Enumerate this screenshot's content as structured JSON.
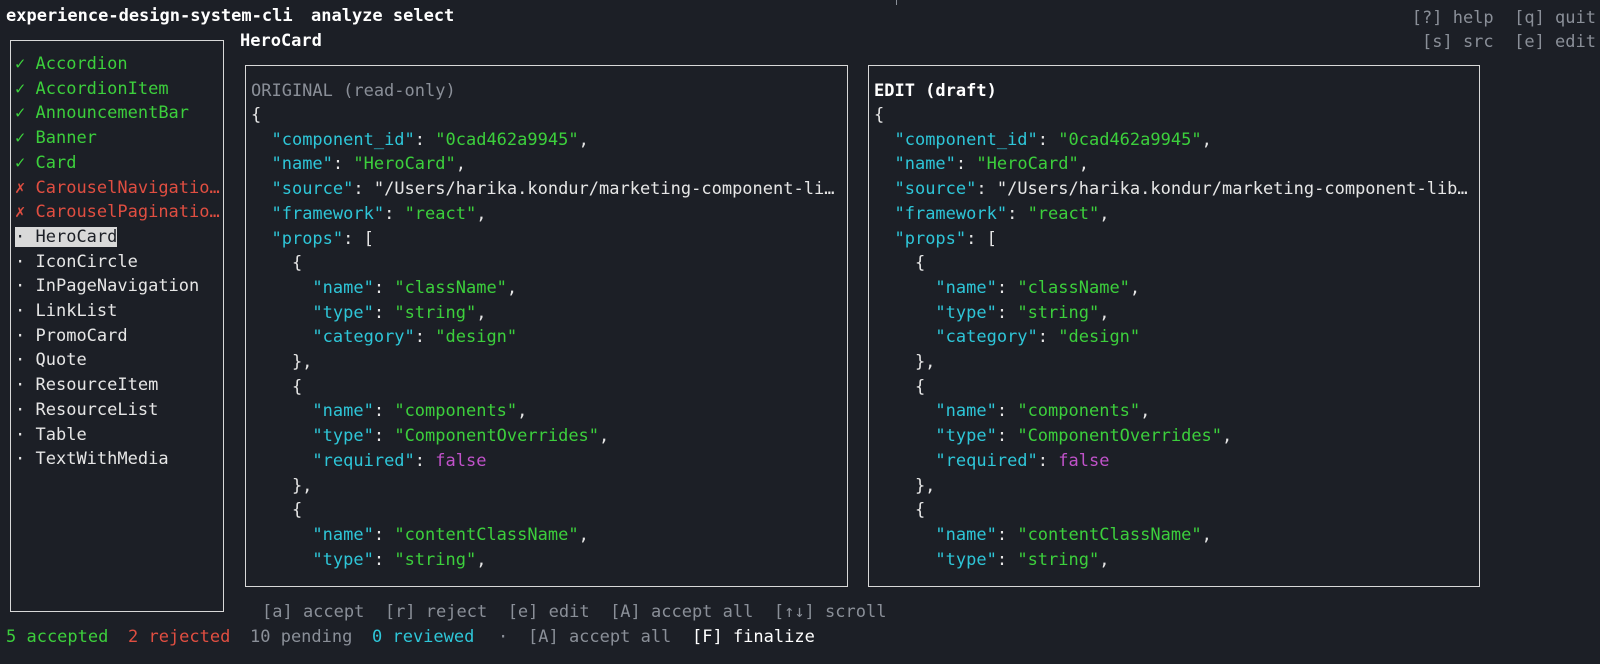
{
  "header": {
    "command": "experience-design-system-cli",
    "mode": "analyze select",
    "hints_row1": "[?] help  [q] quit",
    "hints_row2": "[s] src  [e] edit"
  },
  "selected_component": "HeroCard",
  "sidebar": {
    "items": [
      {
        "mark": "✓",
        "label": "Accordion",
        "status": "accepted"
      },
      {
        "mark": "✓",
        "label": "AccordionItem",
        "status": "accepted"
      },
      {
        "mark": "✓",
        "label": "AnnouncementBar",
        "status": "accepted"
      },
      {
        "mark": "✓",
        "label": "Banner",
        "status": "accepted"
      },
      {
        "mark": "✓",
        "label": "Card",
        "status": "accepted"
      },
      {
        "mark": "✗",
        "label": "CarouselNavigatio…",
        "status": "rejected"
      },
      {
        "mark": "✗",
        "label": "CarouselPaginatio…",
        "status": "rejected"
      },
      {
        "mark": "·",
        "label": "HeroCard",
        "status": "selected"
      },
      {
        "mark": "·",
        "label": "IconCircle",
        "status": "pending"
      },
      {
        "mark": "·",
        "label": "InPageNavigation",
        "status": "pending"
      },
      {
        "mark": "·",
        "label": "LinkList",
        "status": "pending"
      },
      {
        "mark": "·",
        "label": "PromoCard",
        "status": "pending"
      },
      {
        "mark": "·",
        "label": "Quote",
        "status": "pending"
      },
      {
        "mark": "·",
        "label": "ResourceItem",
        "status": "pending"
      },
      {
        "mark": "·",
        "label": "ResourceList",
        "status": "pending"
      },
      {
        "mark": "·",
        "label": "Table",
        "status": "pending"
      },
      {
        "mark": "·",
        "label": "TextWithMedia",
        "status": "pending"
      }
    ]
  },
  "panels": {
    "original_header": "ORIGINAL (read-only)",
    "edit_header": "EDIT (draft)",
    "original_lines": [
      [
        [
          "p",
          "{"
        ]
      ],
      [
        [
          "p",
          "  "
        ],
        [
          "k",
          "\"component_id\""
        ],
        [
          "p",
          ": "
        ],
        [
          "s",
          "\"0cad462a9945\""
        ],
        [
          "p",
          ","
        ]
      ],
      [
        [
          "p",
          "  "
        ],
        [
          "k",
          "\"name\""
        ],
        [
          "p",
          ": "
        ],
        [
          "s",
          "\"HeroCard\""
        ],
        [
          "p",
          ","
        ]
      ],
      [
        [
          "p",
          "  "
        ],
        [
          "k",
          "\"source\""
        ],
        [
          "p",
          ": \"/Users/harika.kondur/marketing-component-lib…"
        ]
      ],
      [
        [
          "p",
          "  "
        ],
        [
          "k",
          "\"framework\""
        ],
        [
          "p",
          ": "
        ],
        [
          "s",
          "\"react\""
        ],
        [
          "p",
          ","
        ]
      ],
      [
        [
          "p",
          "  "
        ],
        [
          "k",
          "\"props\""
        ],
        [
          "p",
          ": ["
        ]
      ],
      [
        [
          "p",
          "    {"
        ]
      ],
      [
        [
          "p",
          "      "
        ],
        [
          "k",
          "\"name\""
        ],
        [
          "p",
          ": "
        ],
        [
          "s",
          "\"className\""
        ],
        [
          "p",
          ","
        ]
      ],
      [
        [
          "p",
          "      "
        ],
        [
          "k",
          "\"type\""
        ],
        [
          "p",
          ": "
        ],
        [
          "s",
          "\"string\""
        ],
        [
          "p",
          ","
        ]
      ],
      [
        [
          "p",
          "      "
        ],
        [
          "k",
          "\"category\""
        ],
        [
          "p",
          ": "
        ],
        [
          "s",
          "\"design\""
        ]
      ],
      [
        [
          "p",
          "    },"
        ]
      ],
      [
        [
          "p",
          "    {"
        ]
      ],
      [
        [
          "p",
          "      "
        ],
        [
          "k",
          "\"name\""
        ],
        [
          "p",
          ": "
        ],
        [
          "s",
          "\"components\""
        ],
        [
          "p",
          ","
        ]
      ],
      [
        [
          "p",
          "      "
        ],
        [
          "k",
          "\"type\""
        ],
        [
          "p",
          ": "
        ],
        [
          "s",
          "\"ComponentOverrides\""
        ],
        [
          "p",
          ","
        ]
      ],
      [
        [
          "p",
          "      "
        ],
        [
          "k",
          "\"required\""
        ],
        [
          "p",
          ": "
        ],
        [
          "b",
          "false"
        ]
      ],
      [
        [
          "p",
          "    },"
        ]
      ],
      [
        [
          "p",
          "    {"
        ]
      ],
      [
        [
          "p",
          "      "
        ],
        [
          "k",
          "\"name\""
        ],
        [
          "p",
          ": "
        ],
        [
          "s",
          "\"contentClassName\""
        ],
        [
          "p",
          ","
        ]
      ],
      [
        [
          "p",
          "      "
        ],
        [
          "k",
          "\"type\""
        ],
        [
          "p",
          ": "
        ],
        [
          "s",
          "\"string\""
        ],
        [
          "p",
          ","
        ]
      ]
    ],
    "edit_lines": [
      [
        [
          "p",
          "{"
        ]
      ],
      [
        [
          "p",
          "  "
        ],
        [
          "k",
          "\"component_id\""
        ],
        [
          "p",
          ": "
        ],
        [
          "s",
          "\"0cad462a9945\""
        ],
        [
          "p",
          ","
        ]
      ],
      [
        [
          "p",
          "  "
        ],
        [
          "k",
          "\"name\""
        ],
        [
          "p",
          ": "
        ],
        [
          "s",
          "\"HeroCard\""
        ],
        [
          "p",
          ","
        ]
      ],
      [
        [
          "p",
          "  "
        ],
        [
          "k",
          "\"source\""
        ],
        [
          "p",
          ": \"/Users/harika.kondur/marketing-component-libr…"
        ]
      ],
      [
        [
          "p",
          "  "
        ],
        [
          "k",
          "\"framework\""
        ],
        [
          "p",
          ": "
        ],
        [
          "s",
          "\"react\""
        ],
        [
          "p",
          ","
        ]
      ],
      [
        [
          "p",
          "  "
        ],
        [
          "k",
          "\"props\""
        ],
        [
          "p",
          ": ["
        ]
      ],
      [
        [
          "p",
          "    {"
        ]
      ],
      [
        [
          "p",
          "      "
        ],
        [
          "k",
          "\"name\""
        ],
        [
          "p",
          ": "
        ],
        [
          "s",
          "\"className\""
        ],
        [
          "p",
          ","
        ]
      ],
      [
        [
          "p",
          "      "
        ],
        [
          "k",
          "\"type\""
        ],
        [
          "p",
          ": "
        ],
        [
          "s",
          "\"string\""
        ],
        [
          "p",
          ","
        ]
      ],
      [
        [
          "p",
          "      "
        ],
        [
          "k",
          "\"category\""
        ],
        [
          "p",
          ": "
        ],
        [
          "s",
          "\"design\""
        ]
      ],
      [
        [
          "p",
          "    },"
        ]
      ],
      [
        [
          "p",
          "    {"
        ]
      ],
      [
        [
          "p",
          "      "
        ],
        [
          "k",
          "\"name\""
        ],
        [
          "p",
          ": "
        ],
        [
          "s",
          "\"components\""
        ],
        [
          "p",
          ","
        ]
      ],
      [
        [
          "p",
          "      "
        ],
        [
          "k",
          "\"type\""
        ],
        [
          "p",
          ": "
        ],
        [
          "s",
          "\"ComponentOverrides\""
        ],
        [
          "p",
          ","
        ]
      ],
      [
        [
          "p",
          "      "
        ],
        [
          "k",
          "\"required\""
        ],
        [
          "p",
          ": "
        ],
        [
          "b",
          "false"
        ]
      ],
      [
        [
          "p",
          "    },"
        ]
      ],
      [
        [
          "p",
          "    {"
        ]
      ],
      [
        [
          "p",
          "      "
        ],
        [
          "k",
          "\"name\""
        ],
        [
          "p",
          ": "
        ],
        [
          "s",
          "\"contentClassName\""
        ],
        [
          "p",
          ","
        ]
      ],
      [
        [
          "p",
          "      "
        ],
        [
          "k",
          "\"type\""
        ],
        [
          "p",
          ": "
        ],
        [
          "s",
          "\"string\""
        ],
        [
          "p",
          ","
        ]
      ]
    ]
  },
  "footer": {
    "actions": [
      "[a] accept",
      "[r] reject",
      "[e] edit",
      "[A] accept all",
      "[↑↓] scroll"
    ],
    "accepted": "5 accepted",
    "rejected": "2 rejected",
    "pending": "10 pending",
    "reviewed": "0 reviewed",
    "separator": "·",
    "accept_all": "[A] accept all",
    "finalize": "[F] finalize"
  },
  "colors": {
    "background": "#1c1f26",
    "accepted": "#3ccf3c",
    "rejected": "#e04e41",
    "key": "#2ec6d8",
    "string": "#3ccf3c",
    "boolean": "#c052c9",
    "muted": "#8a8f98"
  }
}
